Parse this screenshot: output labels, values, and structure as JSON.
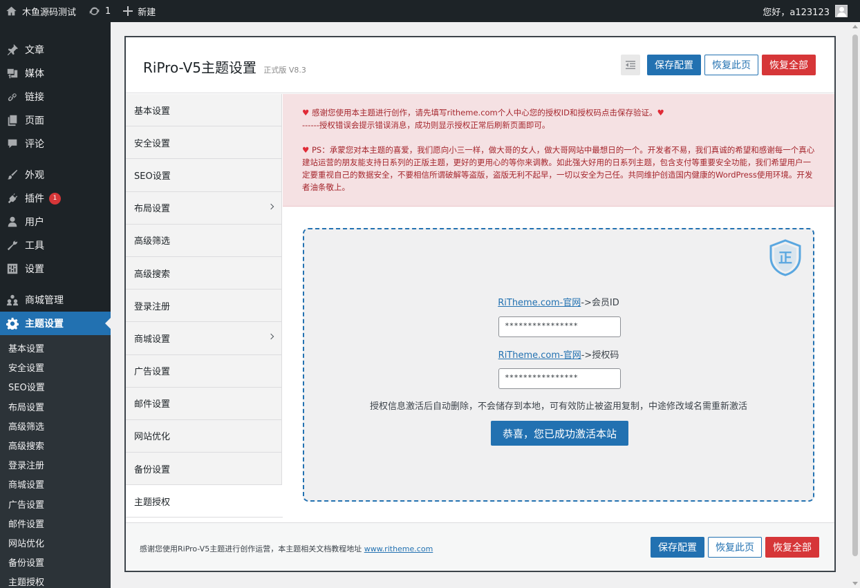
{
  "adminbar": {
    "site_name": "木鱼源码测试",
    "updates_count": "1",
    "new_label": "新建",
    "greeting": "您好，a123123"
  },
  "sidebar": {
    "items": [
      {
        "label": "文章",
        "icon": "pin-icon"
      },
      {
        "label": "媒体",
        "icon": "media-icon"
      },
      {
        "label": "链接",
        "icon": "link-icon"
      },
      {
        "label": "页面",
        "icon": "page-icon"
      },
      {
        "label": "评论",
        "icon": "comment-icon"
      },
      {
        "label": "外观",
        "icon": "brush-icon"
      },
      {
        "label": "插件",
        "icon": "plugin-icon",
        "badge": "1"
      },
      {
        "label": "用户",
        "icon": "user-icon"
      },
      {
        "label": "工具",
        "icon": "wrench-icon"
      },
      {
        "label": "设置",
        "icon": "settings-icon"
      },
      {
        "label": "商城管理",
        "icon": "groups-icon"
      },
      {
        "label": "主题设置",
        "icon": "gear-icon"
      }
    ],
    "submenu": [
      "基本设置",
      "安全设置",
      "SEO设置",
      "布局设置",
      "高级筛选",
      "高级搜索",
      "登录注册",
      "商城设置",
      "广告设置",
      "邮件设置",
      "网站优化",
      "备份设置",
      "主题授权"
    ]
  },
  "panel": {
    "title": "RiPro-V5主题设置",
    "version": "正式版 V8.3",
    "save_label": "保存配置",
    "reset_page_label": "恢复此页",
    "reset_all_label": "恢复全部"
  },
  "nav": {
    "items": [
      "基本设置",
      "安全设置",
      "SEO设置",
      "布局设置",
      "高级筛选",
      "高级搜索",
      "登录注册",
      "商城设置",
      "广告设置",
      "邮件设置",
      "网站优化",
      "备份设置",
      "主题授权"
    ]
  },
  "notice": {
    "line1": "感谢您使用本主题进行创作，请先填写ritheme.com个人中心您的授权ID和授权码点击保存验证。",
    "line2": "------授权错误会提示错误消息，成功则显示授权正常后刷新页面即可。",
    "ps": "PS：承蒙您对本主题的喜爱，我们愿向小三一样，做大哥的女人，做大哥网站中最想日的一个。开发者不易，我们真诚的希望和感谢每一个真心建站运营的朋友能支持日系列的正版主题，更好的更用心的等你来调教。如此强大好用的日系列主题，包含支付等重要安全功能，我们希望用户一定要重视自己的数据安全，不要相信所谓破解等盗版，盗版无利不起早，一切以安全为己任。共同维护创造国内健康的WordPress使用环境。开发者油条敬上。"
  },
  "auth": {
    "shield_char": "正",
    "link_text": "RiTheme.com-官网",
    "member_id_suffix": "->会员ID",
    "member_id_value": "****************",
    "auth_code_suffix": "->授权码",
    "auth_code_value": "****************",
    "note": "授权信息激活后自动删除，不会储存到本地，可有效防止被盗用复制，中途修改域名需重新激活",
    "activated_label": "恭喜，您已成功激活本站"
  },
  "footer": {
    "text": "感谢您使用RiPro-V5主题进行创作运营，本主题相关文档教程地址",
    "link": "www.ritheme.com"
  },
  "colors": {
    "primary": "#2271b1",
    "danger": "#d63638",
    "admin_dark": "#1d2327",
    "notice_bg": "#f5e1e3"
  }
}
